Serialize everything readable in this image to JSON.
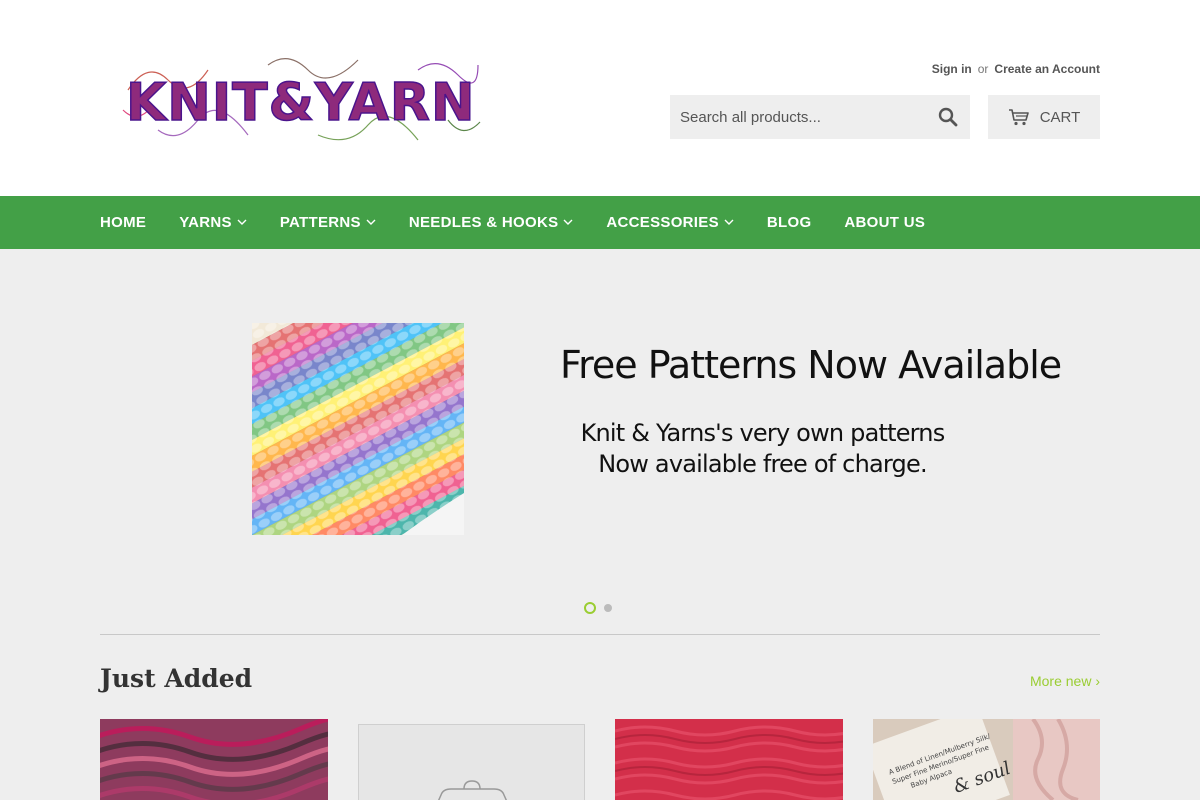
{
  "brand": {
    "logo_text": "KNIT&YARN"
  },
  "account": {
    "sign_in": "Sign in",
    "or": "or",
    "create_account": "Create an Account"
  },
  "search": {
    "placeholder": "Search all products..."
  },
  "cart": {
    "label": "CART"
  },
  "nav": {
    "items": [
      {
        "label": "HOME",
        "dropdown": false
      },
      {
        "label": "YARNS",
        "dropdown": true
      },
      {
        "label": "PATTERNS",
        "dropdown": true
      },
      {
        "label": "NEEDLES & HOOKS",
        "dropdown": true
      },
      {
        "label": "ACCESSORIES",
        "dropdown": true
      },
      {
        "label": "BLOG",
        "dropdown": false
      },
      {
        "label": "ABOUT US",
        "dropdown": false
      }
    ]
  },
  "slideshow": {
    "title": "Free Patterns Now Available",
    "subtitle_line1": "Knit & Yarns's very own patterns",
    "subtitle_line2": "Now available free of charge.",
    "slide_count": 2,
    "active_slide": 1
  },
  "just_added": {
    "title": "Just Added",
    "more_link": "More new ›"
  },
  "colors": {
    "nav_bg": "#43a047",
    "accent": "#9acd32",
    "page_bg": "#eeeeee"
  },
  "icons": {
    "search": "search-icon",
    "cart": "cart-icon",
    "chevron": "chevron-down-icon"
  }
}
